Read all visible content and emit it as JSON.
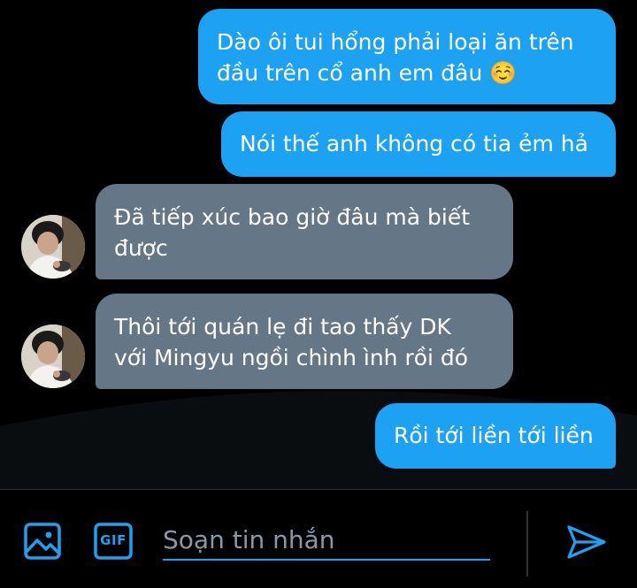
{
  "messages": [
    {
      "sender": "me",
      "text": "Dào ôi tui hổng phải loại ăn trên\nđầu trên cổ anh em đâu ☺️"
    },
    {
      "sender": "me",
      "text": "Nói thế anh không có tia ẻm hả"
    },
    {
      "sender": "them",
      "text": "Đã tiếp xúc bao giờ đâu mà biết\nđược"
    },
    {
      "sender": "them",
      "text": "Thôi tới quán lẹ đi tao thấy DK\nvới Mingyu ngồi chình ình rồi đó"
    },
    {
      "sender": "me",
      "text": "Rồi tới liền tới liền"
    }
  ],
  "composer": {
    "placeholder": "Soạn tin nhắn",
    "gif_label": "GIF",
    "icons": [
      "image-icon",
      "gif-icon",
      "send-icon"
    ]
  },
  "colors": {
    "accent": "#1da1f2",
    "incoming_bubble": "#657786",
    "background": "#000000"
  }
}
